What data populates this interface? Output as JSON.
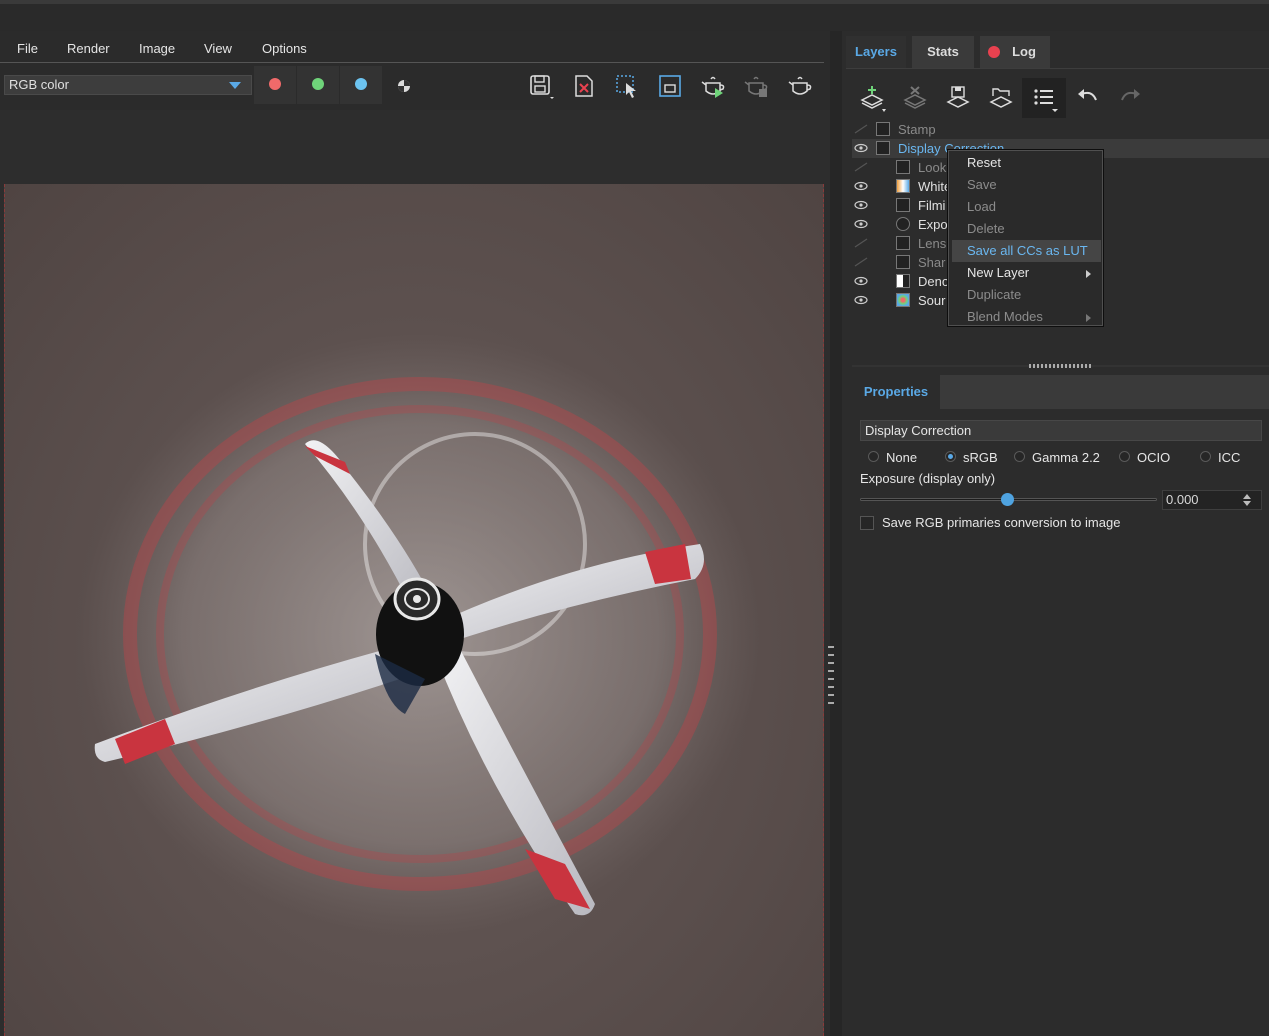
{
  "menubar": {
    "items": [
      "File",
      "Render",
      "Image",
      "View",
      "Options"
    ]
  },
  "toolbar": {
    "channel_select": "RGB color",
    "channels": [
      {
        "name": "red-channel",
        "color": "#f06a6a"
      },
      {
        "name": "green-channel",
        "color": "#6fd47a"
      },
      {
        "name": "blue-channel",
        "color": "#6cc3f0"
      }
    ]
  },
  "right_tabs": {
    "layers": "Layers",
    "stats": "Stats",
    "log": "Log"
  },
  "layers": {
    "items": [
      {
        "label": "Stamp",
        "visible": false,
        "selected": false
      },
      {
        "label": "Display Correction",
        "visible": true,
        "selected": true
      },
      {
        "label": "Look",
        "visible": false,
        "selected": false
      },
      {
        "label": "White",
        "visible": true,
        "selected": false
      },
      {
        "label": "Filmi",
        "visible": true,
        "selected": false
      },
      {
        "label": "Expo",
        "visible": true,
        "selected": false
      },
      {
        "label": "Lens",
        "visible": false,
        "selected": false
      },
      {
        "label": "Shar",
        "visible": false,
        "selected": false
      },
      {
        "label": "Deno",
        "visible": true,
        "selected": false
      },
      {
        "label": "Sour",
        "visible": true,
        "selected": false
      }
    ]
  },
  "context_menu": {
    "items": [
      {
        "label": "Reset",
        "enabled": true,
        "highlight": false,
        "submenu": false
      },
      {
        "label": "Save",
        "enabled": false,
        "highlight": false,
        "submenu": false
      },
      {
        "label": "Load",
        "enabled": false,
        "highlight": false,
        "submenu": false
      },
      {
        "label": "Delete",
        "enabled": false,
        "highlight": false,
        "submenu": false
      },
      {
        "label": "Save all CCs as LUT",
        "enabled": true,
        "highlight": true,
        "submenu": false
      },
      {
        "label": "New Layer",
        "enabled": true,
        "highlight": false,
        "submenu": true
      },
      {
        "label": "Duplicate",
        "enabled": false,
        "highlight": false,
        "submenu": false
      },
      {
        "label": "Blend Modes",
        "enabled": false,
        "highlight": false,
        "submenu": true
      }
    ]
  },
  "properties": {
    "tab": "Properties",
    "header": "Display Correction",
    "radios": [
      {
        "label": "None",
        "checked": false
      },
      {
        "label": "sRGB",
        "checked": true
      },
      {
        "label": "Gamma 2.2",
        "checked": false
      },
      {
        "label": "OCIO",
        "checked": false
      },
      {
        "label": "ICC",
        "checked": false
      }
    ],
    "exposure_label": "Exposure (display only)",
    "exposure_value": "0.000",
    "exposure_fraction": 0.5,
    "save_rgb_label": "Save RGB primaries conversion to image",
    "save_rgb_checked": false
  },
  "colors": {
    "accent": "#5aa9e6",
    "record": "#e8414f"
  }
}
